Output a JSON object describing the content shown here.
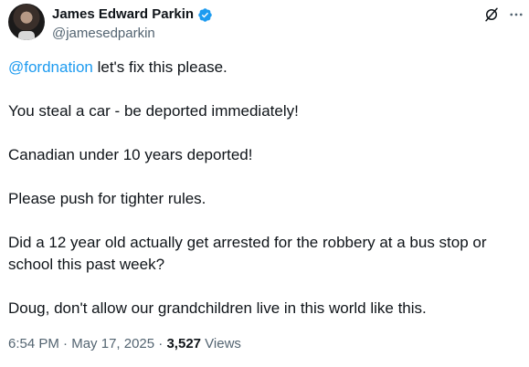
{
  "author": {
    "display_name": "James Edward Parkin",
    "handle": "@jamesedparkin",
    "verified_color": "#1d9bf0"
  },
  "tweet": {
    "mention": "@fordnation",
    "line1_rest": " let's fix this please.",
    "line2": "You steal a car - be deported immediately!",
    "line3": "Canadian under 10 years deported!",
    "line4": "Please push for tighter rules.",
    "line5": "Did a 12 year old actually get arrested for the robbery at a bus stop or school this past week?",
    "line6": "Doug, don't allow our grandchildren live in this world like this."
  },
  "meta": {
    "time": "6:54 PM",
    "sep1": " · ",
    "date": "May 17, 2025",
    "sep2": " · ",
    "views_count": "3,527",
    "views_label": " Views"
  },
  "icons": {
    "grok": "grok-icon",
    "more": "more-icon",
    "verified": "verified-badge-icon"
  },
  "colors": {
    "accent": "#1d9bf0",
    "text": "#0f1419",
    "secondary": "#536471"
  }
}
